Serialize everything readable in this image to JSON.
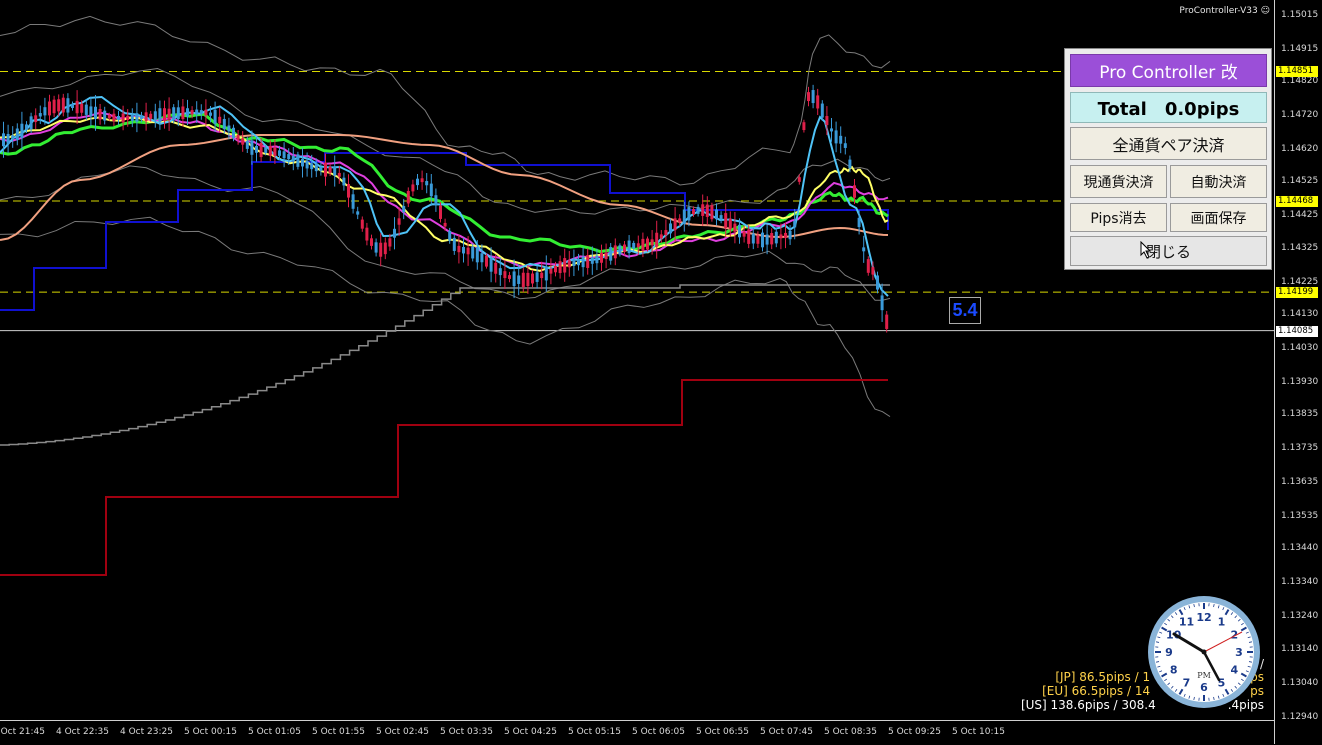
{
  "app": {
    "ea_title": "ProController-V33",
    "ea_icon": "smiley-icon"
  },
  "panel": {
    "title": "Pro Controller 改",
    "total": "Total　0.0pips",
    "close_all_pairs": "全通貨ペア決済",
    "close_current_pair": "現通貨決済",
    "auto_close": "自動決済",
    "delete_pips": "Pips消去",
    "save_screen": "画面保存",
    "exit": "閉じる"
  },
  "spread": "5.4",
  "price_axis": [
    "1.15015",
    "1.14915",
    "1.14820",
    "1.14720",
    "1.14620",
    "1.14525",
    "1.14425",
    "1.14325",
    "1.14225",
    "1.14130",
    "1.14030",
    "1.13930",
    "1.13835",
    "1.13735",
    "1.13635",
    "1.13535",
    "1.13440",
    "1.13340",
    "1.13240",
    "1.13140",
    "1.13040",
    "1.12940"
  ],
  "price_tags": [
    {
      "label": "1.14851",
      "color": "#ffff00"
    },
    {
      "label": "1.14468",
      "color": "#ffff00"
    },
    {
      "label": "1.14199",
      "color": "#ffff00"
    },
    {
      "label": "1.14085",
      "color": "#ffffff"
    }
  ],
  "time_axis": [
    "4 Oct 21:45",
    "4 Oct 22:35",
    "4 Oct 23:25",
    "5 Oct 00:15",
    "5 Oct 01:05",
    "5 Oct 01:55",
    "5 Oct 02:45",
    "5 Oct 03:35",
    "5 Oct 04:25",
    "5 Oct 05:15",
    "5 Oct 06:05",
    "5 Oct 06:55",
    "5 Oct 07:45",
    "5 Oct 08:35",
    "5 Oct 09:25",
    "5 Oct 10:15"
  ],
  "stats": {
    "head": "当日 /",
    "jp": "[JP] 86.5pips / 1",
    "jp_tail": "ps",
    "eu": "[EU] 66.5pips / 14",
    "eu_tail": "ps",
    "us": "[US] 138.6pips / 308.4",
    "us_tail": ".4pips"
  },
  "clock": {
    "period": "PM",
    "numbers": [
      "12",
      "1",
      "2",
      "3",
      "4",
      "5",
      "6",
      "7",
      "8",
      "9",
      "10",
      "11"
    ]
  },
  "colors": {
    "candle_up": "#3a9ad9",
    "candle_down": "#e0204a",
    "ma_fast": "#4fc3f7",
    "ma_yellow": "#ffff66",
    "ma_magenta": "#e040e0",
    "ma_green": "#33ee33",
    "ma_salmon": "#f0a080",
    "channel_blue": "#1010d0",
    "channel_red": "#a00010",
    "bands": "#7a7a7a",
    "hline": "#d8d800",
    "panel_title": "#9b4fd8",
    "total_bg": "#c7f0f0"
  }
}
